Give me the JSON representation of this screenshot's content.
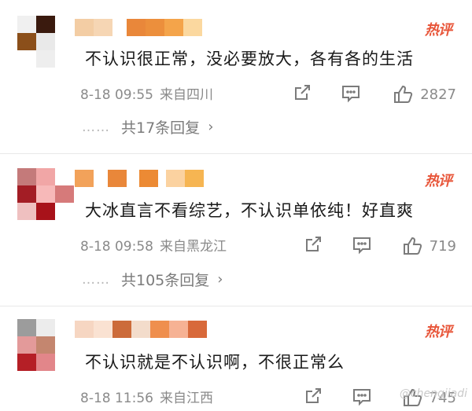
{
  "colors": {
    "hot_badge": "#e8563a",
    "meta_text": "#8a8a8a",
    "body_text": "#1a1a1a",
    "icon_gray": "#7b7b7b"
  },
  "icons": {
    "share": "share-icon",
    "comment": "comment-icon",
    "like": "thumbs-up-icon",
    "chevron": "chevron-right-icon"
  },
  "comments": [
    {
      "hot_label": "热评",
      "text": "不认识很正常，没必要放大，各有各的生活",
      "time": "8-18 09:55",
      "location": "来自四川",
      "likes": "2827",
      "replies_dots": "……",
      "replies_label": "共17条回复",
      "chevron": "›"
    },
    {
      "hot_label": "热评",
      "text": "大冰直言不看综艺，不认识单依纯！好直爽",
      "time": "8-18 09:58",
      "location": "来自黑龙江",
      "likes": "719",
      "replies_dots": "……",
      "replies_label": "共105条回复",
      "chevron": "›"
    },
    {
      "hot_label": "热评",
      "text": "不认识就是不认识啊，不很正常么",
      "time": "8-18 11:56",
      "location": "来自江西",
      "likes": "745"
    }
  ],
  "watermark": "@chengjiadi"
}
